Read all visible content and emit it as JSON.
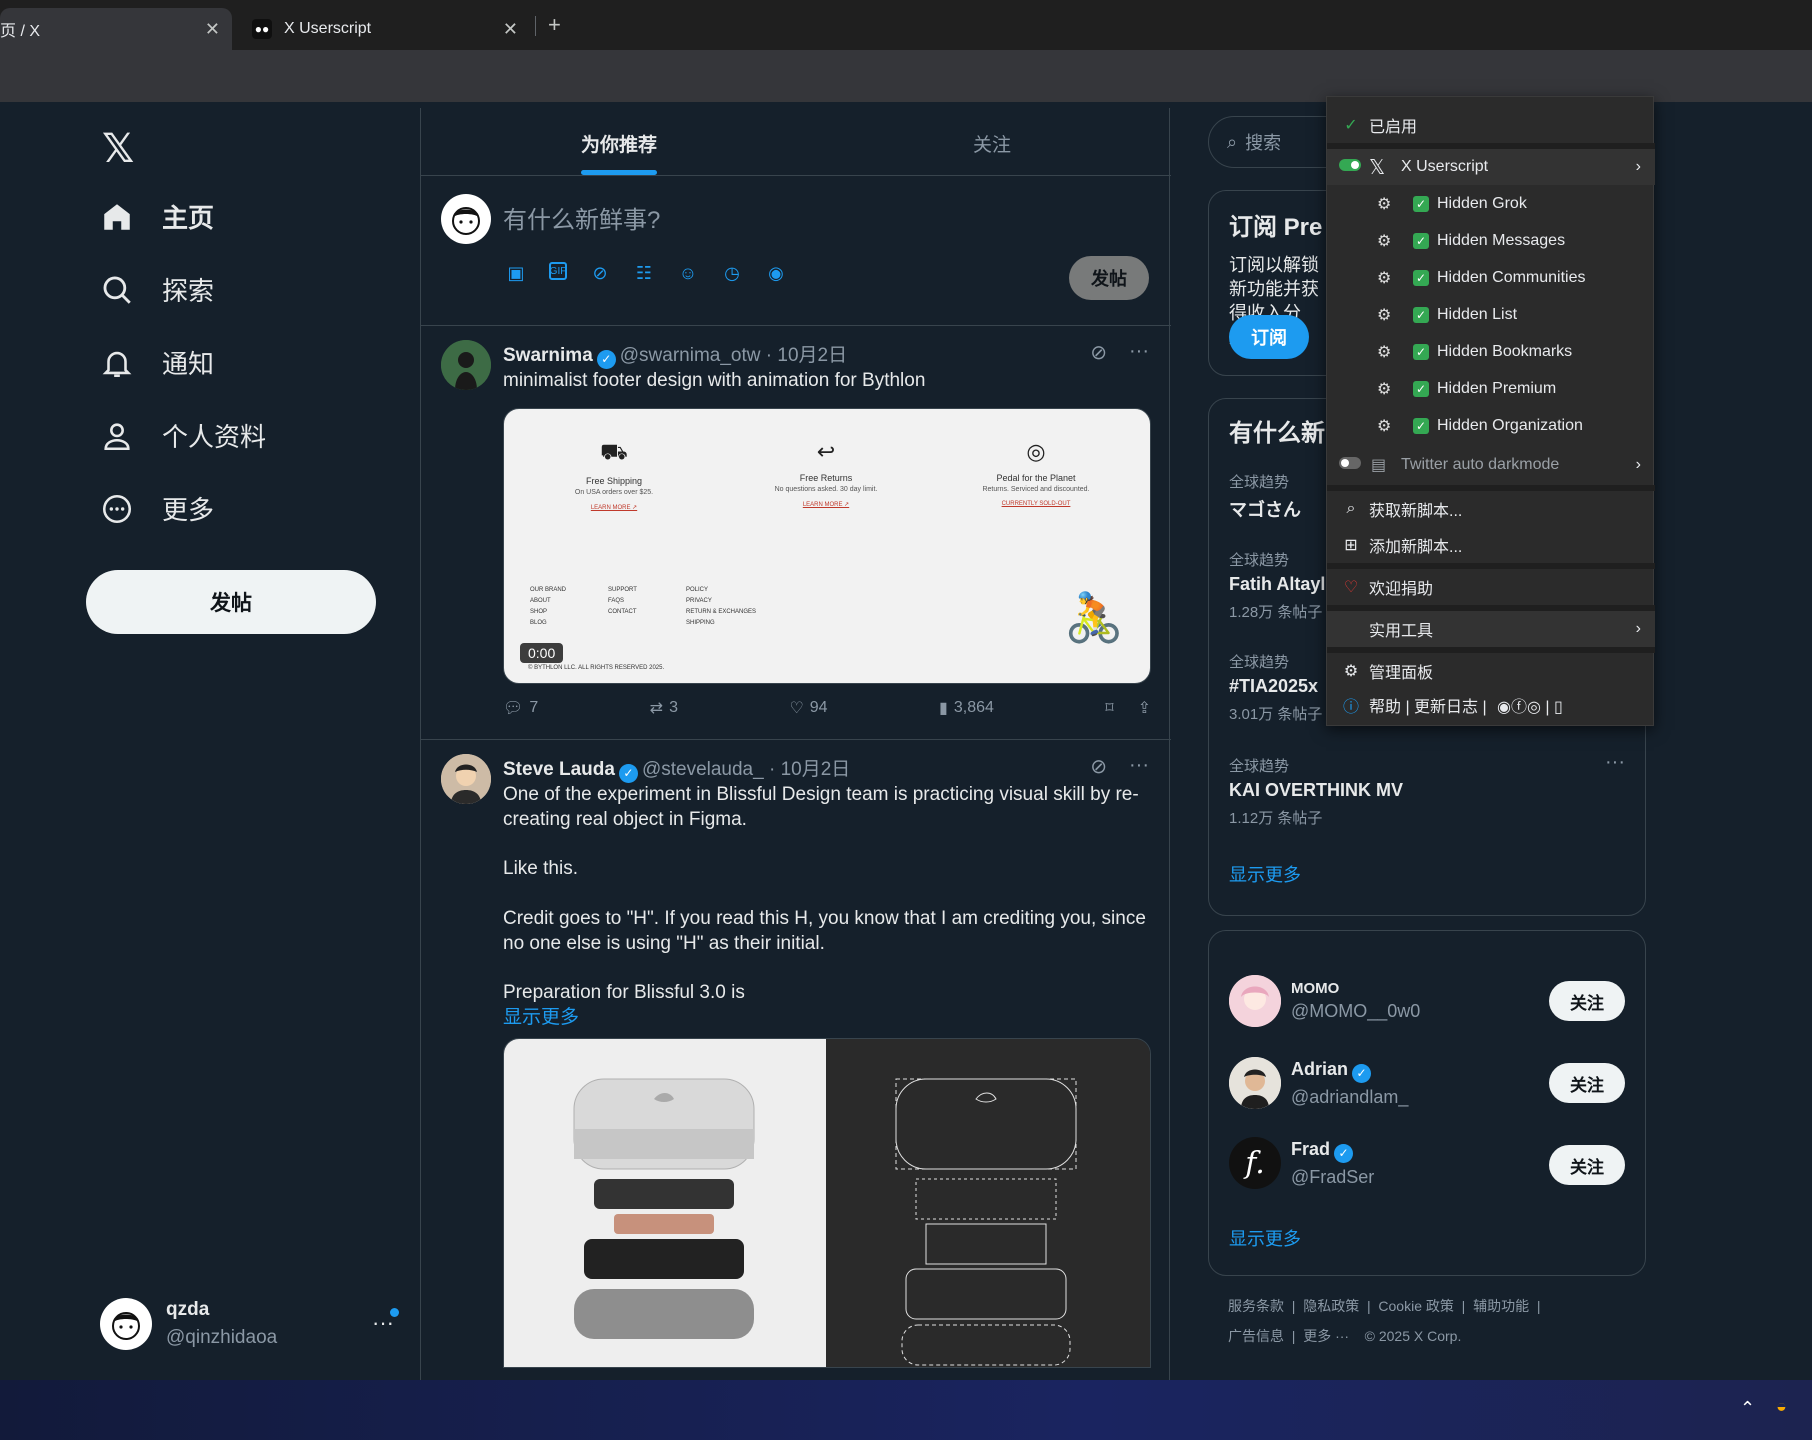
{
  "browser": {
    "tabs": [
      {
        "title": "页 / X",
        "active": true
      },
      {
        "title": "X Userscript",
        "active": false
      }
    ],
    "new_tab": "+",
    "address_fragment": "e"
  },
  "sidebar": {
    "logo": "𝕏",
    "items": [
      {
        "label": "主页",
        "icon": "home-icon"
      },
      {
        "label": "探索",
        "icon": "search-icon"
      },
      {
        "label": "通知",
        "icon": "bell-icon"
      },
      {
        "label": "个人资料",
        "icon": "person-icon"
      },
      {
        "label": "更多",
        "icon": "more-circle-icon"
      }
    ],
    "post_button": "发帖",
    "account": {
      "name": "qzda",
      "handle": "@qinzhidaoa",
      "more": "···"
    }
  },
  "timeline": {
    "tabs": [
      {
        "label": "为你推荐",
        "active": true
      },
      {
        "label": "关注",
        "active": false
      }
    ],
    "composer": {
      "placeholder": "有什么新鲜事?",
      "post_button": "发帖"
    },
    "tweets": [
      {
        "name": "Swarnima",
        "handle": "@swarnima_otw",
        "date": "· 10月2日",
        "text": "minimalist footer design with animation for Bythlon",
        "media": {
          "features": [
            {
              "title": "Free Shipping",
              "sub": "On USA orders over $25.",
              "link": "LEARN MORE ↗"
            },
            {
              "title": "Free Returns",
              "sub": "No questions asked. 30 day limit.",
              "link": "LEARN MORE ↗"
            },
            {
              "title": "Pedal for the Planet",
              "sub": "Returns. Serviced and discounted.",
              "link": "CURRENTLY SOLD-OUT"
            }
          ],
          "footer_cols": [
            [
              "OUR BRAND",
              "ABOUT",
              "SHOP",
              "BLOG"
            ],
            [
              "SUPPORT",
              "FAQS",
              "CONTACT"
            ],
            [
              "POLICY",
              "PRIVACY",
              "RETURN & EXCHANGES",
              "SHIPPING"
            ]
          ],
          "copyright": "© BYTHLON LLC. ALL RIGHTS RESERVED 2025.",
          "video_time": "0:00"
        },
        "actions": {
          "replies": "7",
          "reposts": "3",
          "likes": "94",
          "views": "3,864"
        }
      },
      {
        "name": "Steve Lauda",
        "handle": "@stevelauda_",
        "date": "· 10月2日",
        "paragraphs": [
          "One of the experiment in Blissful Design team is practicing visual skill by re-creating real object in Figma.",
          "Like this.",
          "Credit goes to \"H\". If you read this H, you know that I am crediting you, since no one else is using \"H\" as their initial.",
          "Preparation for Blissful 3.0 is"
        ],
        "show_more": "显示更多"
      }
    ]
  },
  "right": {
    "search_placeholder": "搜索",
    "premium": {
      "title": "订阅 Pre",
      "text": "订阅以解锁新功能并获得收入分成。",
      "button": "订阅"
    },
    "trends": {
      "title": "有什么新",
      "items": [
        {
          "cat": "全球趋势",
          "name": "マゴさん",
          "count": ""
        },
        {
          "cat": "全球趋势",
          "name": "Fatih Altayl",
          "count": "1.28万 条帖子"
        },
        {
          "cat": "全球趋势",
          "name": "#TIA2025x",
          "count": "3.01万 条帖子"
        },
        {
          "cat": "全球趋势",
          "name": "KAI OVERTHINK MV",
          "count": "1.12万 条帖子"
        }
      ],
      "show_more": "显示更多"
    },
    "who_to_follow": {
      "items": [
        {
          "name": "MOMO",
          "handle": "@MOMO__0w0",
          "verified": false,
          "button": "关注"
        },
        {
          "name": "Adrian",
          "handle": "@adriandlam_",
          "verified": true,
          "button": "关注"
        },
        {
          "name": "Frad",
          "handle": "@FradSer",
          "verified": true,
          "button": "关注"
        }
      ],
      "show_more": "显示更多"
    },
    "footer": {
      "line1": [
        "服务条款",
        "隐私政策",
        "Cookie 政策",
        "辅助功能"
      ],
      "line2": [
        "广告信息",
        "更多 ···",
        "© 2025 X Corp."
      ]
    }
  },
  "extension_menu": {
    "enabled": "已启用",
    "script1": "X Userscript",
    "options": [
      "Hidden Grok",
      "Hidden Messages",
      "Hidden Communities",
      "Hidden List",
      "Hidden Bookmarks",
      "Hidden Premium",
      "Hidden Organization"
    ],
    "script2": "Twitter auto darkmode",
    "get_new": "获取新脚本...",
    "add_new": "添加新脚本...",
    "donate": "欢迎捐助",
    "utilities": "实用工具",
    "dashboard": "管理面板",
    "help": "帮助 | 更新日志 |"
  },
  "extension_badges": {
    "tampermonkey": "1",
    "other": "1"
  },
  "colors": {
    "accent": "#1d9bf0",
    "bg": "#15202b",
    "border": "#38444d",
    "toggle_on": "#34a853"
  }
}
